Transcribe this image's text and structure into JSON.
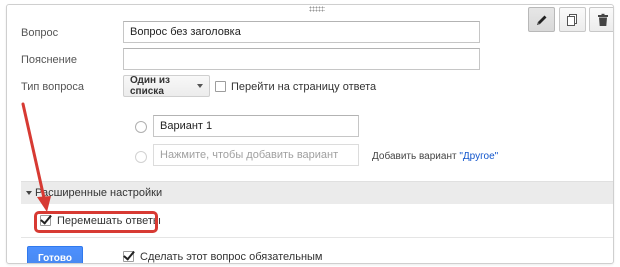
{
  "form": {
    "question_label": "Вопрос",
    "question_value": "Вопрос без заголовка",
    "help_label": "Пояснение",
    "help_value": "",
    "type_label": "Тип вопроса",
    "type_value": "Один из списка",
    "go_to_page_label": "Перейти на страницу ответа",
    "go_to_page_checked": false
  },
  "options": {
    "option1_value": "Вариант 1",
    "add_placeholder": "Нажмите, чтобы добавить вариант",
    "add_other_prefix": "Добавить вариант",
    "add_other_link": "\"Другое\""
  },
  "advanced": {
    "title": "Расширенные настройки",
    "shuffle_label": "Перемешать ответы",
    "shuffle_checked": true
  },
  "footer": {
    "done_label": "Готово",
    "required_label": "Сделать этот вопрос обязательным",
    "required_checked": true
  },
  "toolbar": {
    "icons": [
      "pencil-icon",
      "copy-icon",
      "trash-icon"
    ]
  },
  "colors": {
    "accent_blue": "#4d90fe",
    "highlight_red": "#d73a33",
    "link_blue": "#1155cc"
  }
}
